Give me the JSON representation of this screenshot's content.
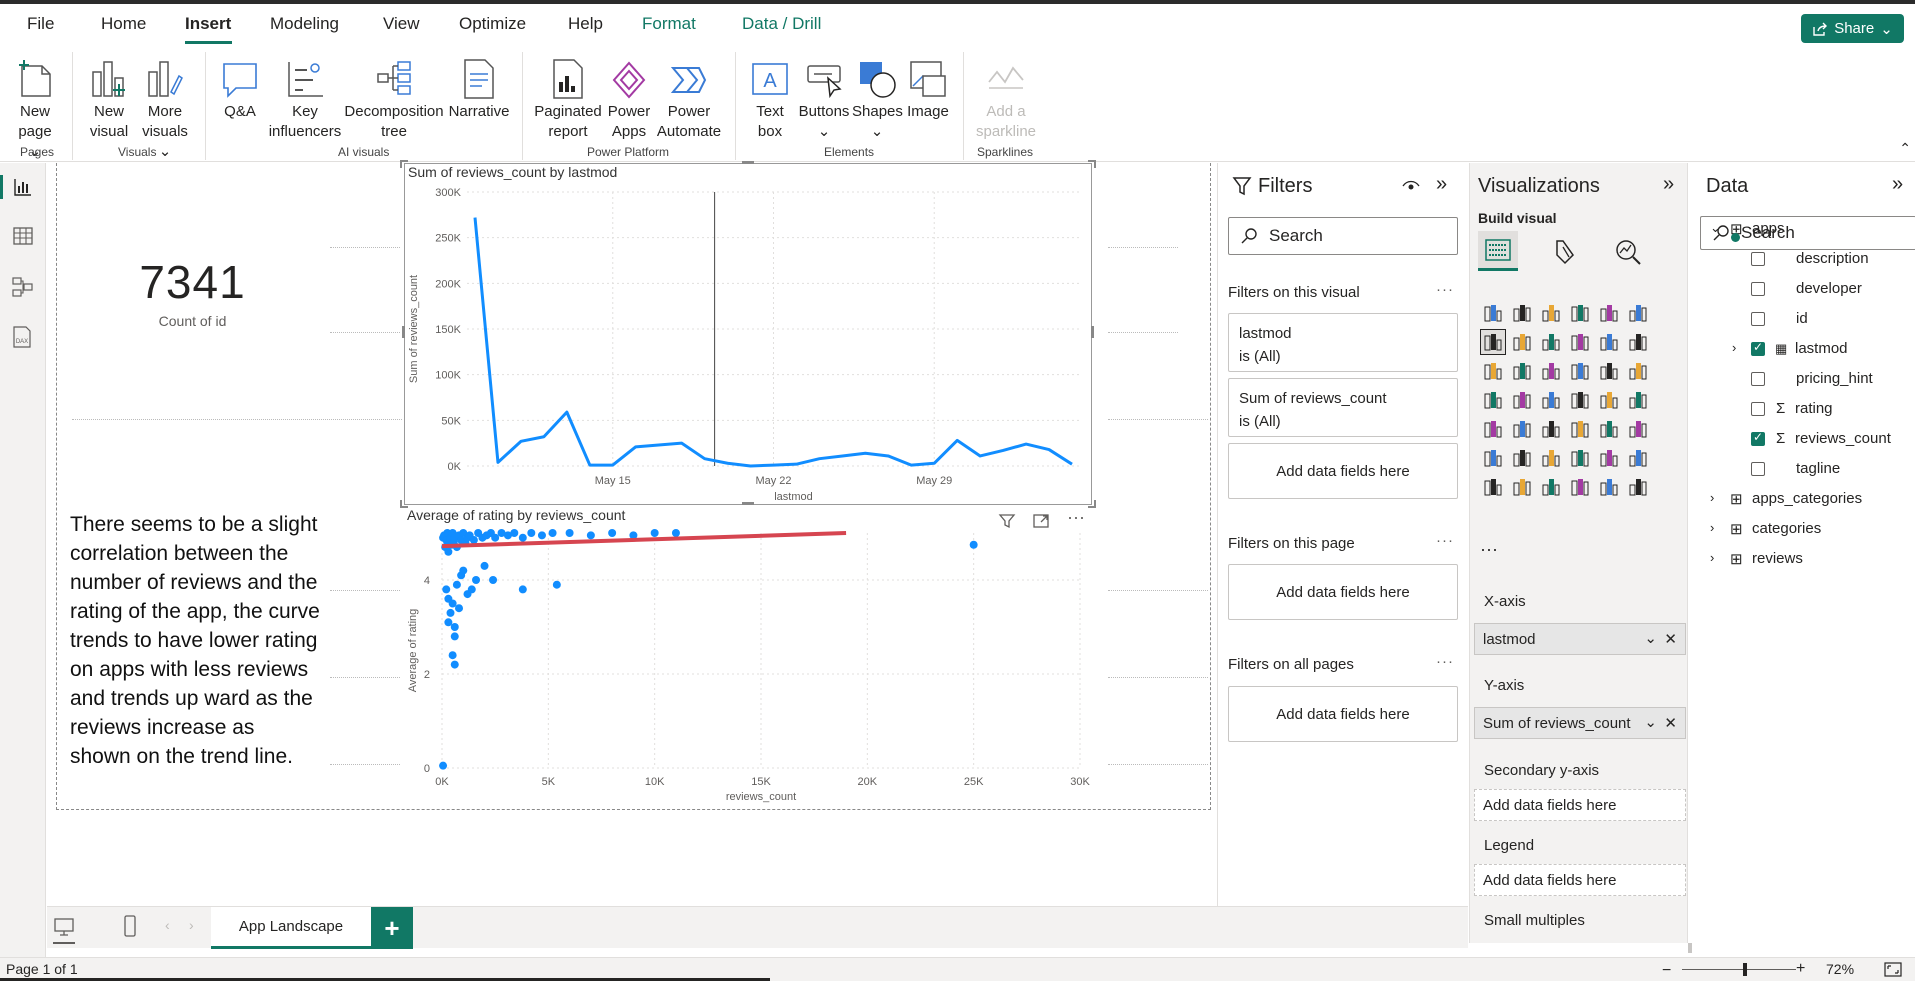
{
  "menu": {
    "tabs": [
      {
        "label": "File"
      },
      {
        "label": "Home"
      },
      {
        "label": "Insert"
      },
      {
        "label": "Modeling"
      },
      {
        "label": "View"
      },
      {
        "label": "Optimize"
      },
      {
        "label": "Help"
      },
      {
        "label": "Format"
      },
      {
        "label": "Data / Drill"
      }
    ],
    "share_label": "Share"
  },
  "ribbon": {
    "new_page": [
      "New",
      "page"
    ],
    "new_visual": [
      "New",
      "visual"
    ],
    "more_visuals": [
      "More",
      "visuals"
    ],
    "qa": "Q&A",
    "key_influencers": [
      "Key",
      "influencers"
    ],
    "decomposition_tree": [
      "Decomposition",
      "tree"
    ],
    "narrative": "Narrative",
    "paginated_report": [
      "Paginated",
      "report"
    ],
    "power_apps": [
      "Power",
      "Apps"
    ],
    "power_automate": [
      "Power",
      "Automate"
    ],
    "text_box": [
      "Text",
      "box"
    ],
    "buttons": "Buttons",
    "shapes": "Shapes",
    "image": "Image",
    "sparkline": [
      "Add a",
      "sparkline"
    ],
    "groups": {
      "pages": "Pages",
      "visuals": "Visuals",
      "ai_visuals": "AI visuals",
      "power_platform": "Power Platform",
      "elements": "Elements",
      "sparklines": "Sparklines"
    }
  },
  "report": {
    "card": {
      "value": "7341",
      "label": "Count of id"
    },
    "textbox": "There seems to be a slight correlation between the number of reviews and the rating of the app, the curve trends to have lower rating on apps with less reviews and trends up ward as the reviews increase as shown on the trend line."
  },
  "chart_data": [
    {
      "type": "line",
      "title": "Sum of reviews_count by lastmod",
      "xlabel": "lastmod",
      "ylabel": "Sum of reviews_count",
      "x_tick_labels": [
        "May 15",
        "May 22",
        "May 29"
      ],
      "y_tick_labels": [
        "0K",
        "50K",
        "100K",
        "150K",
        "200K",
        "250K",
        "300K"
      ],
      "ylim": [
        0,
        300000
      ],
      "x": [
        "May 9",
        "May 10",
        "May 11",
        "May 12",
        "May 13",
        "May 14",
        "May 15",
        "May 16",
        "May 17",
        "May 18",
        "May 19",
        "May 20",
        "May 21",
        "May 22",
        "May 23",
        "May 24",
        "May 25",
        "May 26",
        "May 27",
        "May 28",
        "May 29",
        "May 30",
        "May 31",
        "Jun 1",
        "Jun 2",
        "Jun 3"
      ],
      "values": [
        272000,
        4000,
        27000,
        32000,
        59000,
        1000,
        1000,
        21000,
        23000,
        25000,
        8000,
        3000,
        0,
        1000,
        2000,
        8000,
        11000,
        14000,
        11000,
        1000,
        3000,
        28000,
        11000,
        17000,
        24000,
        18000,
        2000
      ],
      "grid": true
    },
    {
      "type": "scatter",
      "title": "Average of rating by reviews_count",
      "xlabel": "reviews_count",
      "ylabel": "Average of rating",
      "x_tick_labels": [
        "0K",
        "5K",
        "10K",
        "15K",
        "20K",
        "25K",
        "30K"
      ],
      "y_tick_labels": [
        "0",
        "2",
        "4"
      ],
      "xlim": [
        0,
        30000
      ],
      "ylim": [
        0,
        5
      ],
      "points": [
        [
          50,
          4.9
        ],
        [
          100,
          4.95
        ],
        [
          150,
          4.7
        ],
        [
          200,
          4.85
        ],
        [
          250,
          5.0
        ],
        [
          300,
          4.6
        ],
        [
          350,
          4.8
        ],
        [
          400,
          4.9
        ],
        [
          450,
          4.75
        ],
        [
          500,
          5.0
        ],
        [
          550,
          4.8
        ],
        [
          600,
          4.9
        ],
        [
          700,
          4.7
        ],
        [
          800,
          4.95
        ],
        [
          900,
          4.85
        ],
        [
          1000,
          5.0
        ],
        [
          1100,
          4.8
        ],
        [
          1200,
          4.9
        ],
        [
          1300,
          4.95
        ],
        [
          1500,
          4.85
        ],
        [
          1700,
          5.0
        ],
        [
          1900,
          4.9
        ],
        [
          2100,
          4.95
        ],
        [
          2300,
          5.0
        ],
        [
          2500,
          4.9
        ],
        [
          2800,
          5.0
        ],
        [
          3100,
          4.95
        ],
        [
          3400,
          5.0
        ],
        [
          3800,
          4.9
        ],
        [
          4200,
          5.0
        ],
        [
          4700,
          4.95
        ],
        [
          5200,
          5.0
        ],
        [
          6000,
          5.0
        ],
        [
          7000,
          4.95
        ],
        [
          8000,
          5.0
        ],
        [
          9000,
          4.95
        ],
        [
          10000,
          5.0
        ],
        [
          11000,
          5.0
        ],
        [
          25000,
          4.75
        ],
        [
          200,
          3.8
        ],
        [
          300,
          3.6
        ],
        [
          400,
          3.3
        ],
        [
          500,
          3.5
        ],
        [
          600,
          3.0
        ],
        [
          700,
          3.9
        ],
        [
          800,
          3.4
        ],
        [
          900,
          4.1
        ],
        [
          1000,
          4.2
        ],
        [
          1200,
          3.7
        ],
        [
          1400,
          3.8
        ],
        [
          1600,
          4.0
        ],
        [
          2000,
          4.3
        ],
        [
          2400,
          4.0
        ],
        [
          3800,
          3.8
        ],
        [
          5400,
          3.9
        ],
        [
          600,
          2.8
        ],
        [
          500,
          2.4
        ],
        [
          600,
          2.2
        ],
        [
          300,
          3.1
        ],
        [
          50,
          0.05
        ]
      ],
      "trend_line": [
        [
          0,
          4.72
        ],
        [
          19000,
          5.0
        ]
      ],
      "grid": true
    }
  ],
  "filters": {
    "title": "Filters",
    "search_placeholder": "Search",
    "on_visual": "Filters on this visual",
    "cards": [
      {
        "field": "lastmod",
        "state": "is (All)"
      },
      {
        "field": "Sum of reviews_count",
        "state": "is (All)"
      }
    ],
    "add_fields": "Add data fields here",
    "on_page": "Filters on this page",
    "on_all": "Filters on all pages"
  },
  "visualizations": {
    "title": "Visualizations",
    "build_visual": "Build visual",
    "xaxis_label": "X-axis",
    "xaxis_value": "lastmod",
    "yaxis_label": "Y-axis",
    "yaxis_value": "Sum of reviews_count",
    "secondary_label": "Secondary y-axis",
    "legend_label": "Legend",
    "small_multiples": "Small multiples",
    "add_fields": "Add data fields here"
  },
  "data": {
    "title": "Data",
    "search_placeholder": "Search",
    "tables": [
      {
        "name": "apps",
        "expanded": true
      },
      {
        "name": "apps_categories"
      },
      {
        "name": "categories"
      },
      {
        "name": "reviews"
      }
    ],
    "fields": [
      {
        "name": "description",
        "checked": false
      },
      {
        "name": "developer",
        "checked": false
      },
      {
        "name": "id",
        "checked": false
      },
      {
        "name": "lastmod",
        "checked": true
      },
      {
        "name": "pricing_hint",
        "checked": false
      },
      {
        "name": "rating",
        "checked": false
      },
      {
        "name": "reviews_count",
        "checked": true
      },
      {
        "name": "tagline",
        "checked": false
      }
    ]
  },
  "pages": {
    "current": "App Landscape",
    "status": "Page 1 of 1",
    "zoom": "72%"
  },
  "colors": {
    "accent": "#117865",
    "series": "#118dff",
    "trend": "#d64550"
  }
}
